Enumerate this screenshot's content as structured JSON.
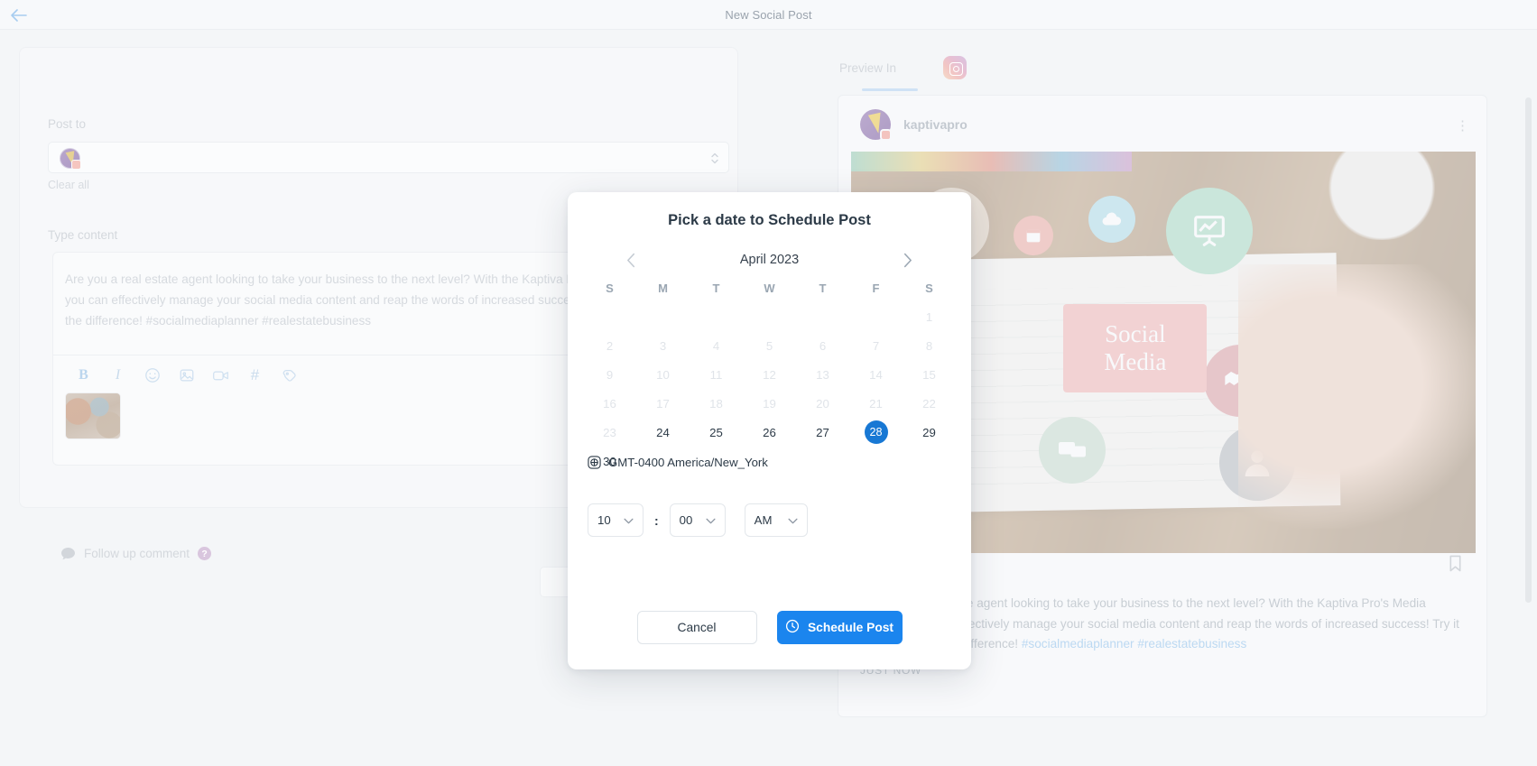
{
  "topbar": {
    "title": "New Social Post",
    "back_icon": "arrow-left-icon"
  },
  "editor": {
    "post_to_label": "Post to",
    "clear_all_label": "Clear all",
    "type_content_label": "Type content",
    "content_text": "Are you a real estate agent looking to take your business to the next level? With the Kaptiva Pro's Media Planner, you can effectively manage your social media content and reap the words of increased success! Try it today and see the difference! #socialmediaplanner #realestatebusiness",
    "toolbar": [
      {
        "name": "bold-icon",
        "glyph": "B"
      },
      {
        "name": "italic-icon",
        "glyph": "I"
      },
      {
        "name": "emoji-icon",
        "glyph": ""
      },
      {
        "name": "image-icon",
        "glyph": ""
      },
      {
        "name": "video-icon",
        "glyph": ""
      },
      {
        "name": "hashtag-icon",
        "glyph": "#"
      },
      {
        "name": "tag-icon",
        "glyph": ""
      }
    ],
    "followup_label": "Follow up comment",
    "help_glyph": "?"
  },
  "preview": {
    "label": "Preview In",
    "active_network": "instagram",
    "username": "kaptivapro",
    "image_center_line1": "Social",
    "image_center_line2": "Media",
    "caption_body": "Are you a real estate agent looking to take your business to the next level? With the Kaptiva Pro's Media Planner, you can effectively manage your social media content and reap the words of increased success! Try it today and see the difference! ",
    "caption_tags": "#socialmediaplanner #realestatebusiness",
    "timestamp": "JUST NOW",
    "menu_glyph": "⋮"
  },
  "modal": {
    "title": "Pick a date to Schedule Post",
    "month_label": "April 2023",
    "prev_icon": "chevron-left-icon",
    "next_icon": "chevron-right-icon",
    "dow": [
      "S",
      "M",
      "T",
      "W",
      "T",
      "F",
      "S"
    ],
    "weeks": [
      [
        null,
        null,
        null,
        null,
        null,
        null,
        {
          "d": "1",
          "state": "disabled"
        }
      ],
      [
        {
          "d": "2",
          "state": "disabled"
        },
        {
          "d": "3",
          "state": "disabled"
        },
        {
          "d": "4",
          "state": "disabled"
        },
        {
          "d": "5",
          "state": "disabled"
        },
        {
          "d": "6",
          "state": "disabled"
        },
        {
          "d": "7",
          "state": "disabled"
        },
        {
          "d": "8",
          "state": "disabled"
        }
      ],
      [
        {
          "d": "9",
          "state": "disabled"
        },
        {
          "d": "10",
          "state": "disabled"
        },
        {
          "d": "11",
          "state": "disabled"
        },
        {
          "d": "12",
          "state": "disabled"
        },
        {
          "d": "13",
          "state": "disabled"
        },
        {
          "d": "14",
          "state": "disabled"
        },
        {
          "d": "15",
          "state": "disabled"
        }
      ],
      [
        {
          "d": "16",
          "state": "disabled"
        },
        {
          "d": "17",
          "state": "disabled"
        },
        {
          "d": "18",
          "state": "disabled"
        },
        {
          "d": "19",
          "state": "disabled"
        },
        {
          "d": "20",
          "state": "disabled"
        },
        {
          "d": "21",
          "state": "disabled"
        },
        {
          "d": "22",
          "state": "disabled"
        }
      ],
      [
        {
          "d": "23",
          "state": "disabled"
        },
        {
          "d": "24",
          "state": "enabled"
        },
        {
          "d": "25",
          "state": "enabled"
        },
        {
          "d": "26",
          "state": "enabled"
        },
        {
          "d": "27",
          "state": "enabled"
        },
        {
          "d": "28",
          "state": "selected"
        },
        {
          "d": "29",
          "state": "enabled"
        }
      ],
      [
        {
          "d": "30",
          "state": "enabled"
        },
        null,
        null,
        null,
        null,
        null,
        null
      ]
    ],
    "selected_day": "28",
    "timezone": "GMT-0400 America/New_York",
    "timezone_icon": "globe-icon",
    "time": {
      "hour": "10",
      "separator": ":",
      "minute": "00",
      "meridiem": "AM"
    },
    "cancel_label": "Cancel",
    "schedule_label": "Schedule Post",
    "schedule_icon": "clock-icon"
  },
  "colors": {
    "accent": "#1b85ee",
    "selected_day": "#1878d4",
    "hashtag": "#bcd9f2",
    "muted_text": "#d4d8dd"
  }
}
